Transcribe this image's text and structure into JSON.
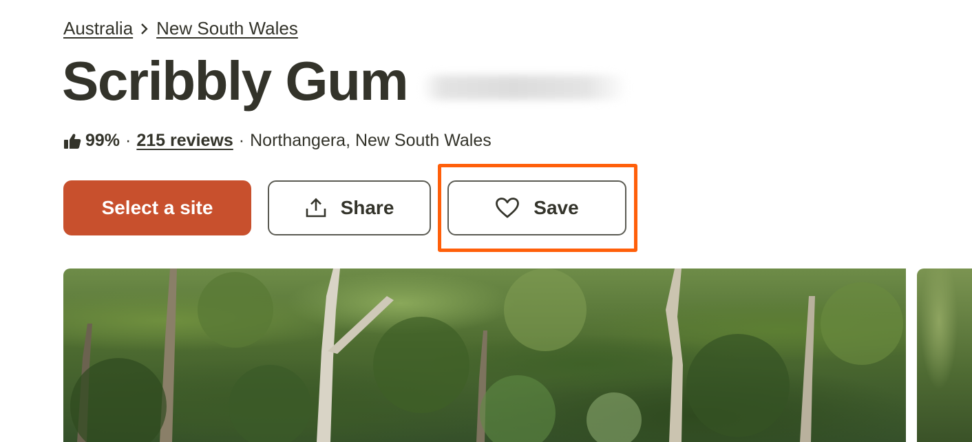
{
  "breadcrumb": {
    "country": "Australia",
    "region": "New South Wales",
    "separator_icon": "chevron-right-icon"
  },
  "header": {
    "title": "Scribbly Gum"
  },
  "meta": {
    "rating_icon": "thumbs-up-icon",
    "rating_percent": "99%",
    "separator": "·",
    "reviews_link": "215 reviews",
    "location": "Northangera, New South Wales"
  },
  "actions": {
    "select_site_label": "Select a site",
    "share_label": "Share",
    "share_icon": "share-upload-icon",
    "save_label": "Save",
    "save_icon": "heart-icon"
  },
  "colors": {
    "primary": "#c8502d",
    "text": "#33332a",
    "highlight": "#ff5f0a"
  }
}
